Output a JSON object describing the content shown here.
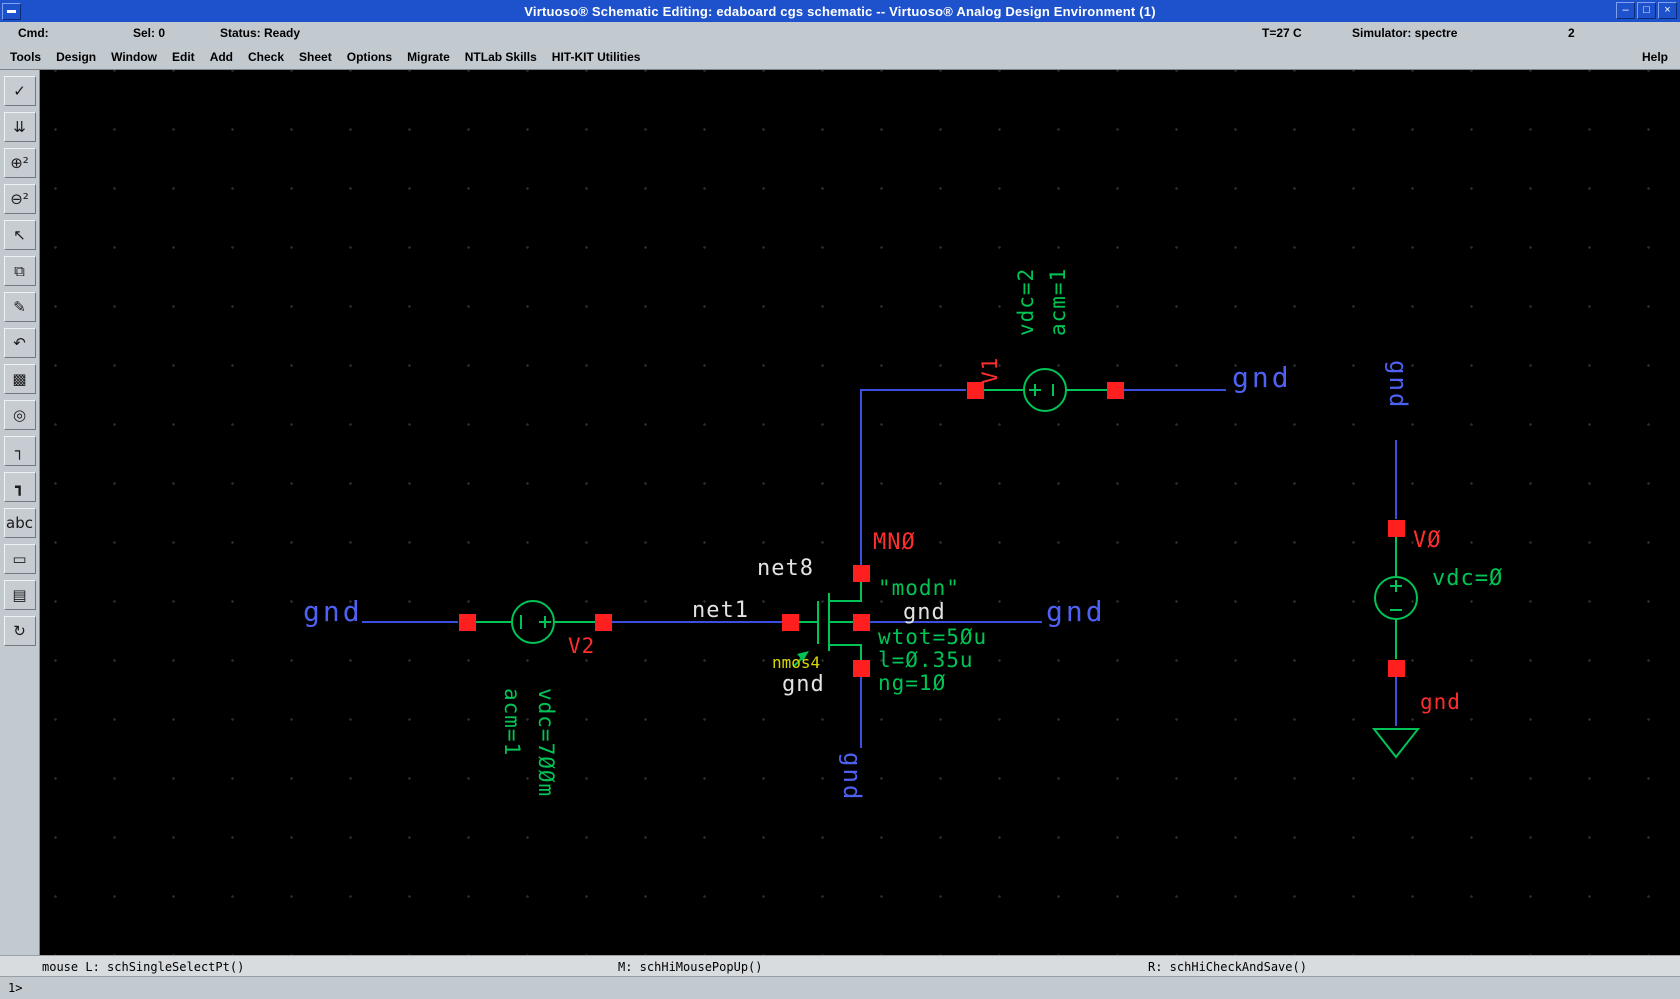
{
  "window": {
    "title": "Virtuoso® Schematic Editing: edaboard cgs schematic -- Virtuoso® Analog Design Environment (1)",
    "controls": {
      "minimize": "–",
      "maximize": "□",
      "close": "×"
    }
  },
  "statusbar": {
    "cmd": "Cmd:",
    "sel": "Sel: 0",
    "status": "Status: Ready",
    "temp": "T=27 C",
    "simulator": "Simulator: spectre",
    "session": "2"
  },
  "menubar": {
    "items": [
      "Tools",
      "Design",
      "Window",
      "Edit",
      "Add",
      "Check",
      "Sheet",
      "Options",
      "Migrate",
      "NTLab Skills",
      "HIT-KIT Utilities"
    ],
    "help": "Help"
  },
  "toolbar": {
    "items": [
      {
        "name": "check-and-save",
        "glyph": "✓"
      },
      {
        "name": "save",
        "glyph": "⇊"
      },
      {
        "name": "zoom-in-2x",
        "glyph": "⊕²"
      },
      {
        "name": "zoom-out-2x",
        "glyph": "⊖²"
      },
      {
        "name": "stretch",
        "glyph": "↖"
      },
      {
        "name": "copy",
        "glyph": "⧉"
      },
      {
        "name": "delete",
        "glyph": "✎"
      },
      {
        "name": "undo",
        "glyph": "↶"
      },
      {
        "name": "property",
        "glyph": "▩"
      },
      {
        "name": "instance",
        "glyph": "◎"
      },
      {
        "name": "wire-narrow",
        "glyph": "┐"
      },
      {
        "name": "wire-wide",
        "glyph": "┓"
      },
      {
        "name": "wire-name",
        "glyph": "abc"
      },
      {
        "name": "pin",
        "glyph": "▭"
      },
      {
        "name": "options",
        "glyph": "▤"
      },
      {
        "name": "repeat",
        "glyph": "↻"
      }
    ]
  },
  "sch": {
    "gnd": "gnd",
    "net1": "net1",
    "net8": "net8",
    "v2_name": "V2",
    "v2_acm": "acm=1",
    "v2_vdc": "vdc=7ØØm",
    "v1_name": "V1",
    "v1_vdc": "vdc=2",
    "v1_acm": "acm=1",
    "v0_name": "VØ",
    "v0_vdc": "vdc=Ø",
    "mn0_name": "MNØ",
    "mn0_model": "\"modn\"",
    "mn0_cell": "nmos4",
    "mn0_wtot": "wtot=5Øu",
    "mn0_l": "l=Ø.35u",
    "mn0_ng": "ng=1Ø"
  },
  "mousebar": {
    "left": "mouse L: schSingleSelectPt()",
    "middle": "M: schHiMousePopUp()",
    "right": "R: schHiCheckAndSave()"
  },
  "prompt": "1>"
}
